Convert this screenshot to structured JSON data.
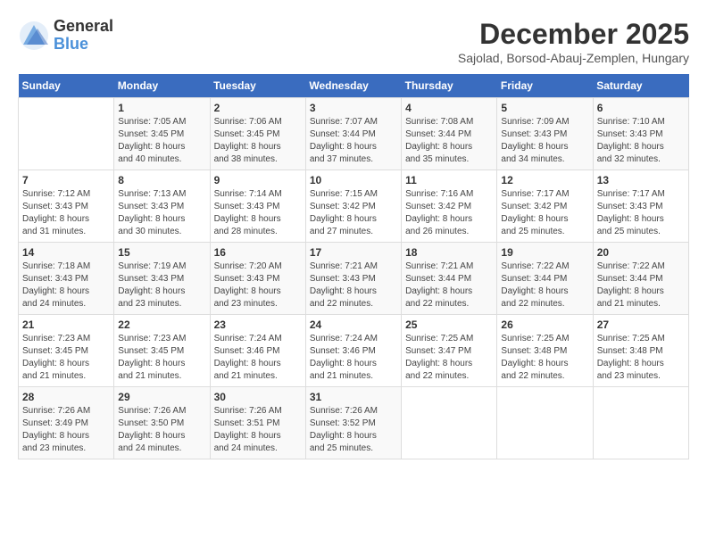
{
  "header": {
    "logo_general": "General",
    "logo_blue": "Blue",
    "title": "December 2025",
    "subtitle": "Sajolad, Borsod-Abauj-Zemplen, Hungary"
  },
  "days_of_week": [
    "Sunday",
    "Monday",
    "Tuesday",
    "Wednesday",
    "Thursday",
    "Friday",
    "Saturday"
  ],
  "weeks": [
    [
      {
        "day": "",
        "sunrise": "",
        "sunset": "",
        "daylight": ""
      },
      {
        "day": "1",
        "sunrise": "Sunrise: 7:05 AM",
        "sunset": "Sunset: 3:45 PM",
        "daylight": "Daylight: 8 hours and 40 minutes."
      },
      {
        "day": "2",
        "sunrise": "Sunrise: 7:06 AM",
        "sunset": "Sunset: 3:45 PM",
        "daylight": "Daylight: 8 hours and 38 minutes."
      },
      {
        "day": "3",
        "sunrise": "Sunrise: 7:07 AM",
        "sunset": "Sunset: 3:44 PM",
        "daylight": "Daylight: 8 hours and 37 minutes."
      },
      {
        "day": "4",
        "sunrise": "Sunrise: 7:08 AM",
        "sunset": "Sunset: 3:44 PM",
        "daylight": "Daylight: 8 hours and 35 minutes."
      },
      {
        "day": "5",
        "sunrise": "Sunrise: 7:09 AM",
        "sunset": "Sunset: 3:43 PM",
        "daylight": "Daylight: 8 hours and 34 minutes."
      },
      {
        "day": "6",
        "sunrise": "Sunrise: 7:10 AM",
        "sunset": "Sunset: 3:43 PM",
        "daylight": "Daylight: 8 hours and 32 minutes."
      }
    ],
    [
      {
        "day": "7",
        "sunrise": "Sunrise: 7:12 AM",
        "sunset": "Sunset: 3:43 PM",
        "daylight": "Daylight: 8 hours and 31 minutes."
      },
      {
        "day": "8",
        "sunrise": "Sunrise: 7:13 AM",
        "sunset": "Sunset: 3:43 PM",
        "daylight": "Daylight: 8 hours and 30 minutes."
      },
      {
        "day": "9",
        "sunrise": "Sunrise: 7:14 AM",
        "sunset": "Sunset: 3:43 PM",
        "daylight": "Daylight: 8 hours and 28 minutes."
      },
      {
        "day": "10",
        "sunrise": "Sunrise: 7:15 AM",
        "sunset": "Sunset: 3:42 PM",
        "daylight": "Daylight: 8 hours and 27 minutes."
      },
      {
        "day": "11",
        "sunrise": "Sunrise: 7:16 AM",
        "sunset": "Sunset: 3:42 PM",
        "daylight": "Daylight: 8 hours and 26 minutes."
      },
      {
        "day": "12",
        "sunrise": "Sunrise: 7:17 AM",
        "sunset": "Sunset: 3:42 PM",
        "daylight": "Daylight: 8 hours and 25 minutes."
      },
      {
        "day": "13",
        "sunrise": "Sunrise: 7:17 AM",
        "sunset": "Sunset: 3:43 PM",
        "daylight": "Daylight: 8 hours and 25 minutes."
      }
    ],
    [
      {
        "day": "14",
        "sunrise": "Sunrise: 7:18 AM",
        "sunset": "Sunset: 3:43 PM",
        "daylight": "Daylight: 8 hours and 24 minutes."
      },
      {
        "day": "15",
        "sunrise": "Sunrise: 7:19 AM",
        "sunset": "Sunset: 3:43 PM",
        "daylight": "Daylight: 8 hours and 23 minutes."
      },
      {
        "day": "16",
        "sunrise": "Sunrise: 7:20 AM",
        "sunset": "Sunset: 3:43 PM",
        "daylight": "Daylight: 8 hours and 23 minutes."
      },
      {
        "day": "17",
        "sunrise": "Sunrise: 7:21 AM",
        "sunset": "Sunset: 3:43 PM",
        "daylight": "Daylight: 8 hours and 22 minutes."
      },
      {
        "day": "18",
        "sunrise": "Sunrise: 7:21 AM",
        "sunset": "Sunset: 3:44 PM",
        "daylight": "Daylight: 8 hours and 22 minutes."
      },
      {
        "day": "19",
        "sunrise": "Sunrise: 7:22 AM",
        "sunset": "Sunset: 3:44 PM",
        "daylight": "Daylight: 8 hours and 22 minutes."
      },
      {
        "day": "20",
        "sunrise": "Sunrise: 7:22 AM",
        "sunset": "Sunset: 3:44 PM",
        "daylight": "Daylight: 8 hours and 21 minutes."
      }
    ],
    [
      {
        "day": "21",
        "sunrise": "Sunrise: 7:23 AM",
        "sunset": "Sunset: 3:45 PM",
        "daylight": "Daylight: 8 hours and 21 minutes."
      },
      {
        "day": "22",
        "sunrise": "Sunrise: 7:23 AM",
        "sunset": "Sunset: 3:45 PM",
        "daylight": "Daylight: 8 hours and 21 minutes."
      },
      {
        "day": "23",
        "sunrise": "Sunrise: 7:24 AM",
        "sunset": "Sunset: 3:46 PM",
        "daylight": "Daylight: 8 hours and 21 minutes."
      },
      {
        "day": "24",
        "sunrise": "Sunrise: 7:24 AM",
        "sunset": "Sunset: 3:46 PM",
        "daylight": "Daylight: 8 hours and 21 minutes."
      },
      {
        "day": "25",
        "sunrise": "Sunrise: 7:25 AM",
        "sunset": "Sunset: 3:47 PM",
        "daylight": "Daylight: 8 hours and 22 minutes."
      },
      {
        "day": "26",
        "sunrise": "Sunrise: 7:25 AM",
        "sunset": "Sunset: 3:48 PM",
        "daylight": "Daylight: 8 hours and 22 minutes."
      },
      {
        "day": "27",
        "sunrise": "Sunrise: 7:25 AM",
        "sunset": "Sunset: 3:48 PM",
        "daylight": "Daylight: 8 hours and 23 minutes."
      }
    ],
    [
      {
        "day": "28",
        "sunrise": "Sunrise: 7:26 AM",
        "sunset": "Sunset: 3:49 PM",
        "daylight": "Daylight: 8 hours and 23 minutes."
      },
      {
        "day": "29",
        "sunrise": "Sunrise: 7:26 AM",
        "sunset": "Sunset: 3:50 PM",
        "daylight": "Daylight: 8 hours and 24 minutes."
      },
      {
        "day": "30",
        "sunrise": "Sunrise: 7:26 AM",
        "sunset": "Sunset: 3:51 PM",
        "daylight": "Daylight: 8 hours and 24 minutes."
      },
      {
        "day": "31",
        "sunrise": "Sunrise: 7:26 AM",
        "sunset": "Sunset: 3:52 PM",
        "daylight": "Daylight: 8 hours and 25 minutes."
      },
      {
        "day": "",
        "sunrise": "",
        "sunset": "",
        "daylight": ""
      },
      {
        "day": "",
        "sunrise": "",
        "sunset": "",
        "daylight": ""
      },
      {
        "day": "",
        "sunrise": "",
        "sunset": "",
        "daylight": ""
      }
    ]
  ]
}
